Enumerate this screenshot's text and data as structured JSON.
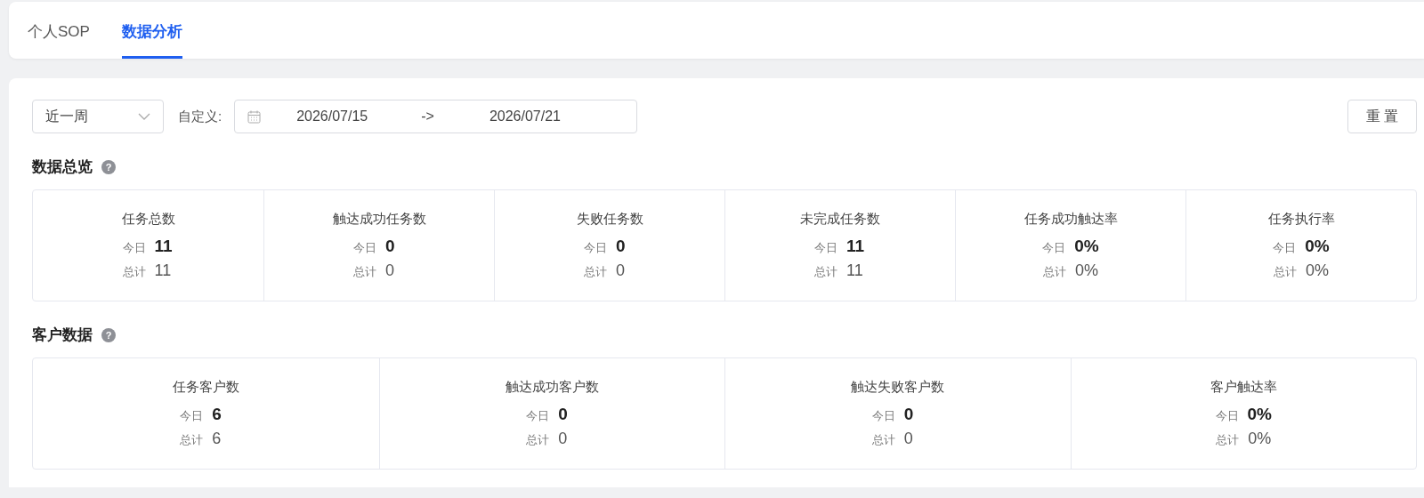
{
  "tabs": [
    {
      "label": "个人SOP",
      "selected": false
    },
    {
      "label": "数据分析",
      "selected": true
    }
  ],
  "filters": {
    "period": "近一周",
    "custom_label": "自定义:",
    "start_date": "2026/07/15",
    "separator": "->",
    "end_date": "2026/07/21",
    "reset_button": "重 置"
  },
  "sections": [
    {
      "title": "数据总览",
      "help": "?",
      "stats": [
        {
          "title": "任务总数",
          "today_label": "今日",
          "today": "11",
          "total_label": "总计",
          "total": "11"
        },
        {
          "title": "触达成功任务数",
          "today_label": "今日",
          "today": "0",
          "total_label": "总计",
          "total": "0"
        },
        {
          "title": "失败任务数",
          "today_label": "今日",
          "today": "0",
          "total_label": "总计",
          "total": "0"
        },
        {
          "title": "未完成任务数",
          "today_label": "今日",
          "today": "11",
          "total_label": "总计",
          "total": "11"
        },
        {
          "title": "任务成功触达率",
          "today_label": "今日",
          "today": "0%",
          "total_label": "总计",
          "total": "0%"
        },
        {
          "title": "任务执行率",
          "today_label": "今日",
          "today": "0%",
          "total_label": "总计",
          "total": "0%"
        }
      ]
    },
    {
      "title": "客户数据",
      "help": "?",
      "stats": [
        {
          "title": "任务客户数",
          "today_label": "今日",
          "today": "6",
          "total_label": "总计",
          "total": "6"
        },
        {
          "title": "触达成功客户数",
          "today_label": "今日",
          "today": "0",
          "total_label": "总计",
          "total": "0"
        },
        {
          "title": "触达失败客户数",
          "today_label": "今日",
          "today": "0",
          "total_label": "总计",
          "total": "0"
        },
        {
          "title": "客户触达率",
          "today_label": "今日",
          "today": "0%",
          "total_label": "总计",
          "total": "0%"
        }
      ]
    }
  ]
}
